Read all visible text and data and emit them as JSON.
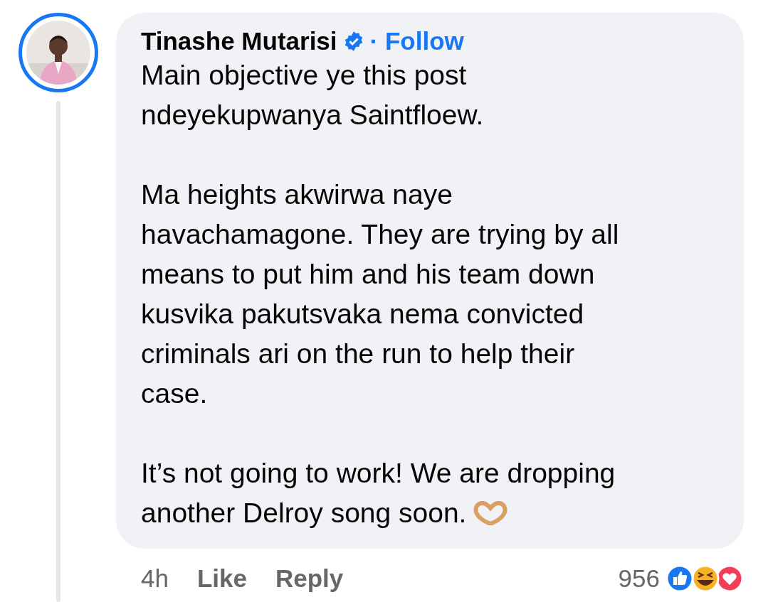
{
  "comment": {
    "author": "Tinashe Mutarisi",
    "verified": true,
    "follow": "· Follow",
    "paragraphs": [
      [
        "Main objective ye this post",
        "ndeyekupwanya Saintfloew."
      ],
      [
        "Ma heights akwirwa naye",
        "havachamagone. They are trying by all",
        "means to put him and his team down",
        "kusvika pakutsvaka nema convicted",
        "criminals ari on the run to help their",
        "case."
      ],
      [
        "It’s not going to work! We are dropping",
        "another Delroy song soon."
      ]
    ],
    "time": "4h",
    "actions": [
      "Like",
      "Reply"
    ],
    "reaction_count": "956"
  }
}
